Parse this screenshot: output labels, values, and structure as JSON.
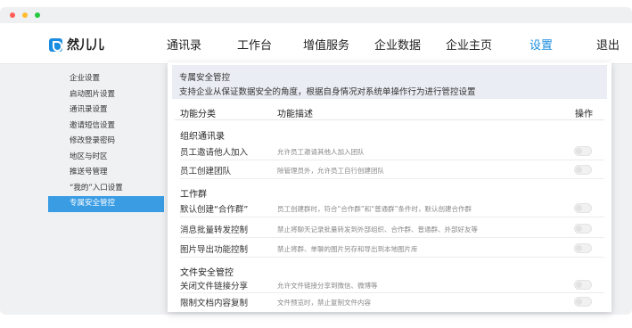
{
  "window": {
    "dots": [
      "#ff5f57",
      "#febc2e",
      "#28c840"
    ]
  },
  "brand": {
    "name": "然儿儿",
    "color": "#1b8de0"
  },
  "nav": [
    {
      "label": "通讯录"
    },
    {
      "label": "工作台"
    },
    {
      "label": "增值服务"
    },
    {
      "label": "企业数据"
    },
    {
      "label": "企业主页"
    },
    {
      "label": "设置",
      "active": true
    },
    {
      "label": "退出"
    }
  ],
  "sidebar": {
    "items": [
      {
        "label": "企业设置"
      },
      {
        "label": "启动图片设置"
      },
      {
        "label": "通讯录设置"
      },
      {
        "label": "邀请短信设置"
      },
      {
        "label": "修改登录密码"
      },
      {
        "label": "地区与时区"
      },
      {
        "label": "推送号管理"
      },
      {
        "label": "“我的”入口设置"
      },
      {
        "label": "专属安全管控",
        "active": true
      }
    ]
  },
  "panel": {
    "title": "专属安全管控",
    "subtitle": "支持企业从保证数据安全的角度，根据自身情况对系统单操作行为进行管控设置",
    "columns": {
      "category": "功能分类",
      "description": "功能描述",
      "action": "操作"
    },
    "groups": [
      {
        "title": "组织通讯录",
        "rows": [
          {
            "name": "员工邀请他人加入",
            "desc": "允许员工邀请其他人加入团队",
            "enabled": false
          },
          {
            "name": "员工创建团队",
            "desc": "除管理员外，允许员工自行创建团队",
            "enabled": false
          }
        ]
      },
      {
        "title": "工作群",
        "rows": [
          {
            "name": "默认创建“合作群”",
            "desc": "员工创建群时，符合“合作群”和“普通群”条件时，默认创建合作群",
            "enabled": false
          },
          {
            "name": "消息批量转发控制",
            "desc": "禁止将聊天记录批量转发到外部组织、合作群、普通群、外部好友等",
            "enabled": false
          },
          {
            "name": "图片导出功能控制",
            "desc": "禁止将群、单聊的图片另存和导出到本地图片库",
            "enabled": false
          }
        ]
      },
      {
        "title": "文件安全管控",
        "rows": [
          {
            "name": "关闭文件链接分享",
            "desc": "允许文件链接分享到微信、微博等",
            "enabled": false
          },
          {
            "name": "限制文档内容复制",
            "desc": "文件预览时，禁止复制文件内容",
            "enabled": false
          }
        ]
      }
    ]
  }
}
